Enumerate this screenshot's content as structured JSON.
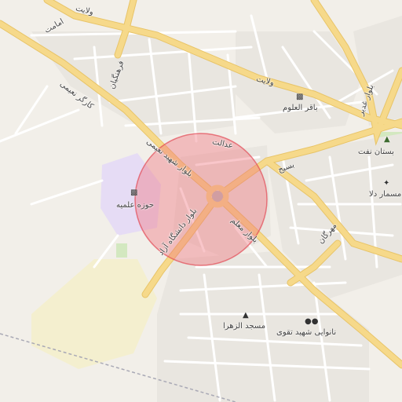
{
  "map": {
    "colors": {
      "background": "#f2efe9",
      "major_road": "#f6d98a",
      "major_road_edge": "#e8c468",
      "minor_road": "#ffffff",
      "block": "#e8e4dc",
      "park": "#d3e8c0",
      "school_area": "#e6dcf5",
      "sand_area": "#f4efcf",
      "circle_fill": "#f0707a",
      "circle_stroke": "#e34a55"
    },
    "road_labels": {
      "velayat_top": "ولایت",
      "emamat": "امامت",
      "farhangian": "فرهنگیان",
      "kargar_naimi": "کارگر نعیمی",
      "velayat_mid": "ولایت",
      "boulevard_ghadir": "بلوار غدیر",
      "edalat": "عدالت",
      "basij": "بسیج",
      "boulevard_shahid_naimi": "بلوار شهید نعیمی",
      "boulevard_daneshgah_azad": "بلوار دانشگاه آزاد",
      "boulevard_moallem": "بلوار معلم",
      "mehrgan": "مهرگان"
    },
    "pois": {
      "bagher_oloom": "باقر العلوم",
      "bustan_naft": "بستان نفت",
      "mesmar_dala": "مسمار دلا",
      "howze_elmiye": "حوزه علمیه",
      "masjed_zahra": "مسجد الزهرا",
      "nanvayi_taghavi": "نانوایی شهید تقوی"
    },
    "icons": {
      "bagher_oloom": "school-icon",
      "bustan_naft": "tree-icon",
      "mesmar_dala": "restaurant-icon",
      "howze_elmiye": "school-icon",
      "masjed_zahra": "mosque-icon",
      "nanvayi_taghavi": "bakery-icon"
    }
  }
}
